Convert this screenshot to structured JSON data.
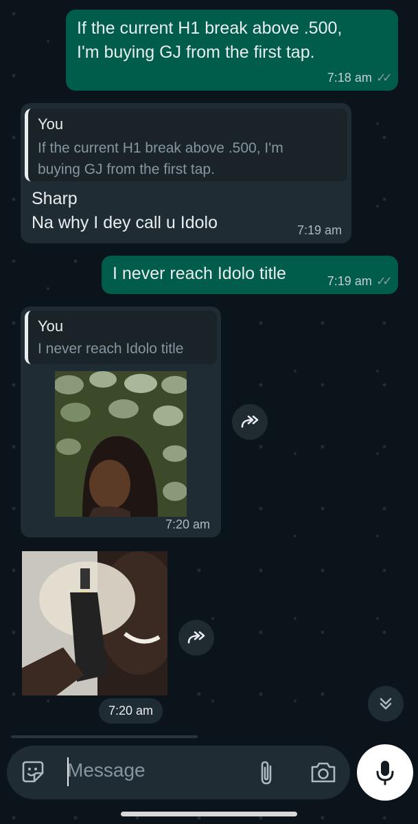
{
  "messages": {
    "m1": {
      "text_line1": "If the current H1 break above .500,",
      "text_line2": "I'm buying GJ from the first tap.",
      "time": "7:18 am",
      "ticks": "✓✓"
    },
    "m2": {
      "quote_author": "You",
      "quote_line1": "If the current H1 break above .500, I'm",
      "quote_line2": "buying GJ from the first tap.",
      "text_line1": "Sharp",
      "text_line2": "Na why I dey call u Idolo",
      "time": "7:19 am"
    },
    "m3": {
      "text": "I never reach Idolo title",
      "time": "7:19 am",
      "ticks": "✓✓"
    },
    "m4": {
      "quote_author": "You",
      "quote_text": "I never reach Idolo title",
      "time": "7:20 am",
      "image": "smiling-woman-sticker"
    },
    "m5": {
      "time": "7:20 am",
      "image": "man-with-gun-sticker"
    }
  },
  "composer": {
    "placeholder": "Message"
  },
  "colors": {
    "outgoing": "#005c4b",
    "incoming": "#202c33",
    "background": "#0b141a"
  }
}
